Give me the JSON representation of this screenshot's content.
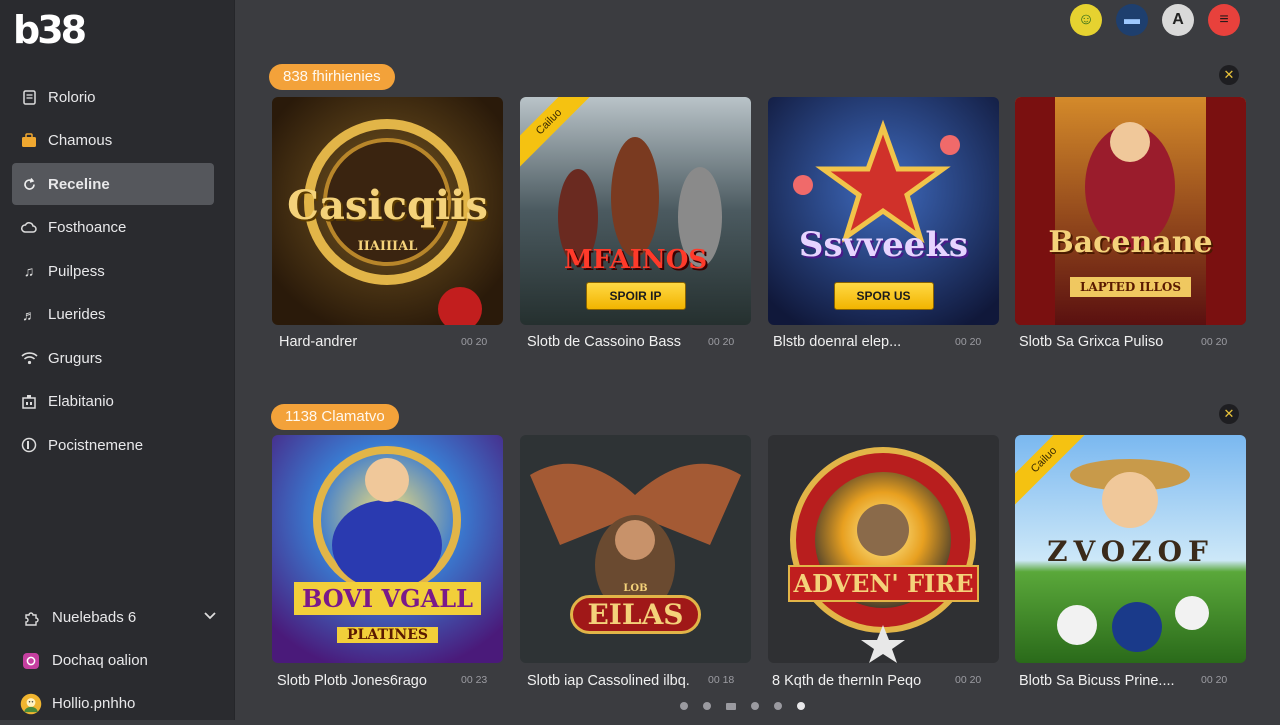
{
  "brand": {
    "logo": "b38"
  },
  "sidebar": {
    "items": [
      {
        "label": "Rolorio",
        "icon": "document-icon"
      },
      {
        "label": "Chamous",
        "icon": "briefcase-icon"
      },
      {
        "label": "Receline",
        "icon": "refresh-icon",
        "active": true
      },
      {
        "label": "Fosthoance",
        "icon": "cloud-icon"
      },
      {
        "label": "Puilpess",
        "icon": "music-note-icon"
      },
      {
        "label": "Luerides",
        "icon": "music-notes-icon"
      },
      {
        "label": "Grugurs",
        "icon": "wifi-icon"
      },
      {
        "label": "Elabitanio",
        "icon": "building-icon"
      },
      {
        "label": "Pocistnemene",
        "icon": "contact-icon"
      }
    ],
    "bottom": [
      {
        "label": "Nuelebads 6",
        "icon": "puzzle-icon"
      },
      {
        "label": "Dochaq oalion",
        "icon": "camera-icon"
      },
      {
        "label": "Hollio.pnhho",
        "icon": "avatar"
      }
    ]
  },
  "header": {
    "icons": [
      "smiley-icon",
      "flag-icon",
      "letter-a-icon",
      "menu-icon"
    ],
    "icon_glyphs": [
      "☺",
      "▬",
      "A",
      "≡"
    ]
  },
  "sections": [
    {
      "title": "838 fhirhienies",
      "cards": [
        {
          "title": "Hard-andrer",
          "meta": "00 20",
          "art": "Casicqiis",
          "art_sub": "IIAIIIAL"
        },
        {
          "title": "Slotb de Cassoino Bass",
          "meta": "00 20",
          "art": "MFAINOS",
          "button": "SPOIR IP",
          "ribbon": "Cailuo"
        },
        {
          "title": "Blstb doenral elep...",
          "meta": "00 20",
          "art": "Ssvveeks",
          "button": "SPOR US"
        },
        {
          "title": "Slotb Sa Grixca Puliso",
          "meta": "00 20",
          "art": "Bacenane",
          "art_sub": "LAPTED ILLOS"
        }
      ]
    },
    {
      "title": "1138 Clamatvo",
      "cards": [
        {
          "title": "Slotb Plotb Jones6rago",
          "meta": "00 23",
          "art": "BOVI VGALL",
          "art_sub": "PLATINES"
        },
        {
          "title": "Slotb iap Cassolined ilbq.",
          "meta": "00 18",
          "art": "EILAS",
          "art_sub": "LOB"
        },
        {
          "title": "8 Kqth de thernIn Peqo",
          "meta": "00 20",
          "art": "ADVEN' FIRE"
        },
        {
          "title": "Blotb Sa Bicuss Prine....",
          "meta": "00 20",
          "art": "ZVOZOF",
          "ribbon": "Cailuo"
        }
      ]
    }
  ],
  "pagination": {
    "count": 6,
    "active_index": 5
  }
}
